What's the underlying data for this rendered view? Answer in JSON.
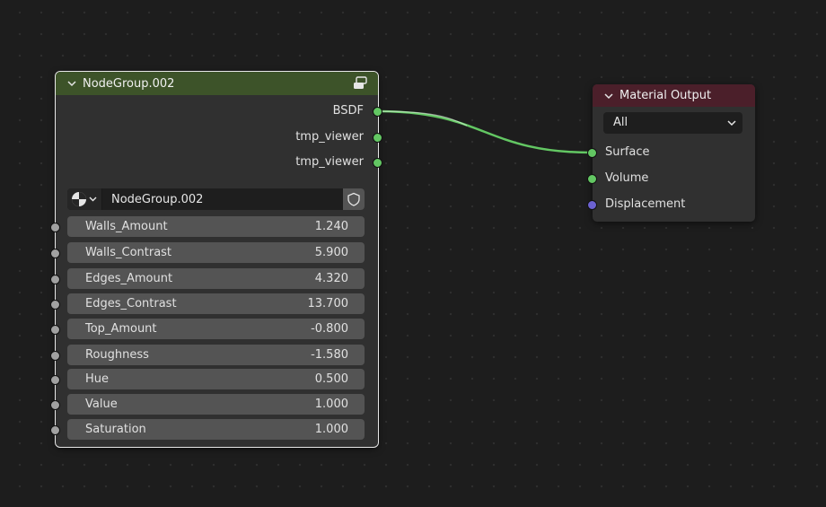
{
  "group_node": {
    "title": "NodeGroup.002",
    "header_color": "#3d5329",
    "outputs": [
      "BSDF",
      "tmp_viewer",
      "tmp_viewer"
    ],
    "datablock_name": "NodeGroup.002",
    "inputs": [
      {
        "label": "Walls_Amount",
        "value": "1.240"
      },
      {
        "label": "Walls_Contrast",
        "value": "5.900"
      },
      {
        "label": "Edges_Amount",
        "value": "4.320"
      },
      {
        "label": "Edges_Contrast",
        "value": "13.700"
      },
      {
        "label": "Top_Amount",
        "value": "-0.800"
      },
      {
        "label": "Roughness",
        "value": "-1.580"
      },
      {
        "label": "Hue",
        "value": "0.500"
      },
      {
        "label": "Value",
        "value": "1.000"
      },
      {
        "label": "Saturation",
        "value": "1.000"
      }
    ],
    "icons": {
      "header": "node-tree-icon",
      "datablock_type": "material-sphere-icon",
      "fake_user": "shield-icon"
    }
  },
  "output_node": {
    "title": "Material Output",
    "header_color": "#4b1f2a",
    "target": "All",
    "inputs": [
      "Surface",
      "Volume",
      "Displacement"
    ]
  },
  "colors": {
    "shader_socket": "#63c763",
    "vector_socket": "#6c62d1",
    "float_socket": "#a1a1a1",
    "link": "#63c763"
  }
}
